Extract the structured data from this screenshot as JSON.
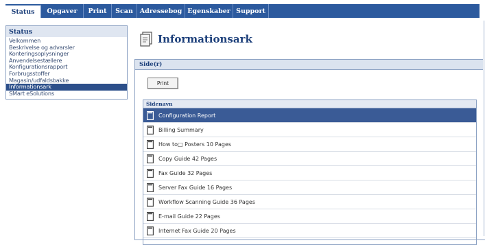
{
  "tabs": [
    {
      "label": "Status",
      "active": true
    },
    {
      "label": "Opgaver",
      "active": false
    },
    {
      "label": "Print",
      "active": false
    },
    {
      "label": "Scan",
      "active": false
    },
    {
      "label": "Adressebog",
      "active": false
    },
    {
      "label": "Egenskaber",
      "active": false
    },
    {
      "label": "Support",
      "active": false
    }
  ],
  "sidebar": {
    "title": "Status",
    "items": [
      {
        "label": "Velkommen"
      },
      {
        "label": "Beskrivelse og advarsler"
      },
      {
        "label": "Konteringsoplysninger"
      },
      {
        "label": "Anvendelsestællere"
      },
      {
        "label": "Konfigurationsrapport"
      },
      {
        "label": "Forbrugsstoffer"
      },
      {
        "label": "Magasin/udfaldsbakke"
      },
      {
        "label": "Informationsark",
        "selected": true
      },
      {
        "label": "SMart eSolutions"
      }
    ]
  },
  "main": {
    "title": "Informationsark",
    "title_icon": "information-sheet-icon",
    "panel_title": "Side(r)",
    "print_label": "Print",
    "list_header": "Sidenavn",
    "pages": [
      {
        "name": "Configuration Report",
        "selected": true
      },
      {
        "name": "Billing Summary"
      },
      {
        "name": "How to□ Posters 10 Pages"
      },
      {
        "name": "Copy Guide 42 Pages"
      },
      {
        "name": "Fax Guide 32 Pages"
      },
      {
        "name": "Server Fax Guide 16 Pages"
      },
      {
        "name": "Workflow Scanning Guide 36 Pages"
      },
      {
        "name": "E-mail Guide 22 Pages"
      },
      {
        "name": "Internet Fax Guide 20 Pages"
      }
    ]
  },
  "colors": {
    "accent": "#2c5a9e",
    "selected_row": "#3a5b96",
    "header_bg": "#dbe3ef"
  }
}
